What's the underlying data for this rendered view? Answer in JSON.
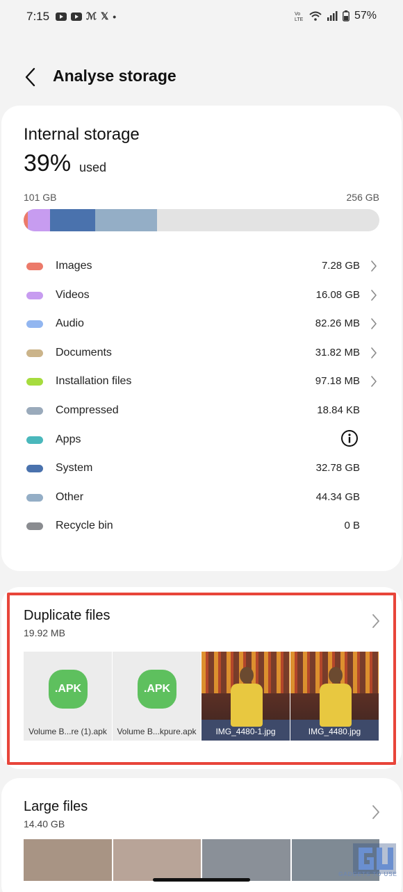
{
  "status_bar": {
    "time": "7:15",
    "left_glyph": "𝕏",
    "dot": "•",
    "battery": "57%"
  },
  "header": {
    "title": "Analyse storage"
  },
  "storage": {
    "title": "Internal storage",
    "percent": "39%",
    "used_label": "used",
    "used_amount": "101 GB",
    "total": "256 GB",
    "bar_segments": [
      {
        "name": "Images",
        "color": "#ec7a6a",
        "fraction": 0.011
      },
      {
        "name": "Videos",
        "color": "#c79cf0",
        "fraction": 0.063
      },
      {
        "name": "System",
        "color": "#4a72ad",
        "fraction": 0.128
      },
      {
        "name": "Other",
        "color": "#94aec6",
        "fraction": 0.173
      }
    ],
    "categories": [
      {
        "label": "Images",
        "size": "7.28 GB",
        "color": "#ec7a6a",
        "icon": "chevron-right-icon"
      },
      {
        "label": "Videos",
        "size": "16.08 GB",
        "color": "#c79cf0",
        "icon": "chevron-right-icon"
      },
      {
        "label": "Audio",
        "size": "82.26 MB",
        "color": "#92b6f0",
        "icon": "chevron-right-icon"
      },
      {
        "label": "Documents",
        "size": "31.82 MB",
        "color": "#cbb48a",
        "icon": "chevron-right-icon"
      },
      {
        "label": "Installation files",
        "size": "97.18 MB",
        "color": "#a6dc3e",
        "icon": "chevron-right-icon"
      },
      {
        "label": "Compressed",
        "size": "18.84 KB",
        "color": "#9aaabb",
        "icon": ""
      },
      {
        "label": "Apps",
        "size": "",
        "color": "#4ab8bc",
        "icon": "info-icon"
      },
      {
        "label": "System",
        "size": "32.78 GB",
        "color": "#4a72ad",
        "icon": ""
      },
      {
        "label": "Other",
        "size": "44.34 GB",
        "color": "#94aec6",
        "icon": ""
      },
      {
        "label": "Recycle bin",
        "size": "0 B",
        "color": "#8a8c90",
        "icon": ""
      }
    ]
  },
  "duplicates": {
    "title": "Duplicate files",
    "size": "19.92 MB",
    "apk_badge": ".APK",
    "files": [
      {
        "name": "Volume B...re (1).apk",
        "kind": "apk"
      },
      {
        "name": "Volume B...kpure.apk",
        "kind": "apk"
      },
      {
        "name": "IMG_4480-1.jpg",
        "kind": "photo"
      },
      {
        "name": "IMG_4480.jpg",
        "kind": "photo"
      }
    ]
  },
  "large_files": {
    "title": "Large files",
    "size": "14.40 GB"
  },
  "watermark": {
    "text": "GADGETS TO USE"
  }
}
